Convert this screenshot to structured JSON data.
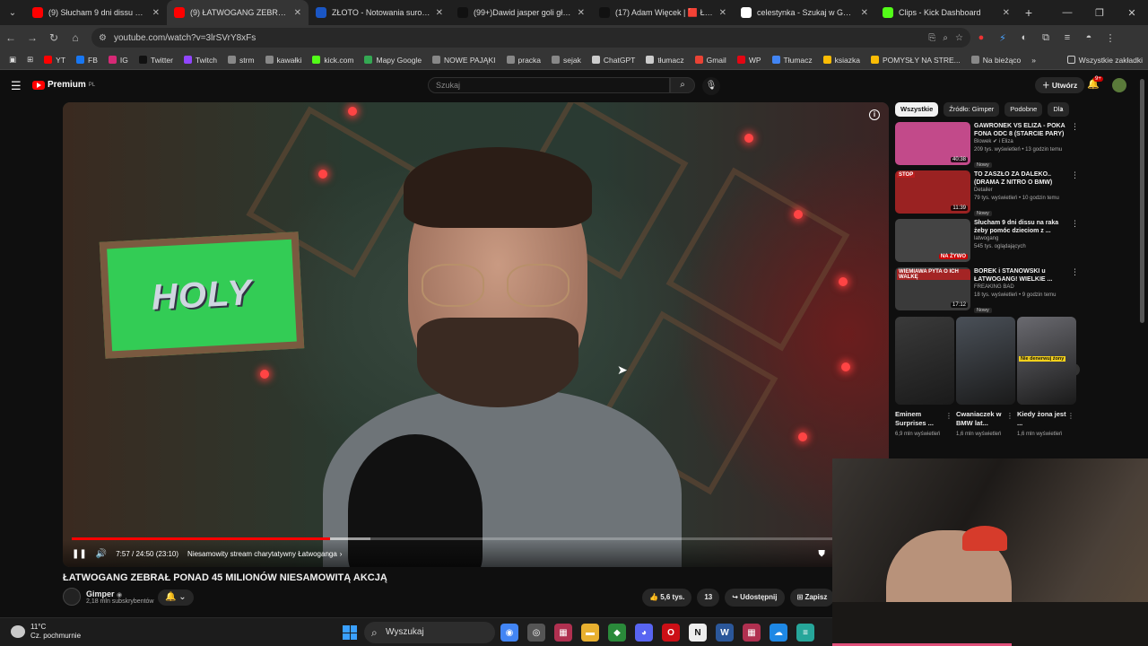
{
  "tabs": [
    {
      "title": "(9) Słucham 9 dni dissu na raka",
      "icon": "youtube-icon",
      "color": "#ff0000",
      "active": false
    },
    {
      "title": "(9) ŁATWOGANG ZEBRAŁ P",
      "icon": "youtube-icon",
      "color": "#ff0000",
      "active": true
    },
    {
      "title": "ZŁOTO - Notowania surowców",
      "icon": "bankier-icon",
      "color": "#1a56c4",
      "active": false
    },
    {
      "title": "(99+)Dawid jasper goli głowę",
      "icon": "tiktok-icon",
      "color": "#111111",
      "active": false
    },
    {
      "title": "(17) Adam Więcek | 🟥 Łowca",
      "icon": "x-icon",
      "color": "#111111",
      "active": false
    },
    {
      "title": "celestynka - Szukaj w Google",
      "icon": "google-icon",
      "color": "#ffffff",
      "active": false
    },
    {
      "title": "Clips - Kick Dashboard",
      "icon": "kick-icon",
      "color": "#53fc18",
      "active": false
    }
  ],
  "address": {
    "url": "youtube.com/watch?v=3lrSVrY8xFs"
  },
  "bookmarks": [
    {
      "label": "YT",
      "color": "#ff0000"
    },
    {
      "label": "FB",
      "color": "#1877f2"
    },
    {
      "label": "IG",
      "color": "#d62976"
    },
    {
      "label": "Twitter",
      "color": "#111111"
    },
    {
      "label": "Twitch",
      "color": "#9146ff"
    },
    {
      "label": "strm",
      "color": "#888888"
    },
    {
      "label": "kawałki",
      "color": "#888888"
    },
    {
      "label": "kick.com",
      "color": "#53fc18"
    },
    {
      "label": "Mapy Google",
      "color": "#34a853"
    },
    {
      "label": "NOWE PAJĄKI",
      "color": "#888888"
    },
    {
      "label": "pracka",
      "color": "#888888"
    },
    {
      "label": "sejak",
      "color": "#888888"
    },
    {
      "label": "ChatGPT",
      "color": "#cccccc"
    },
    {
      "label": "tłumacz",
      "color": "#cccccc"
    },
    {
      "label": "Gmail",
      "color": "#ea4335"
    },
    {
      "label": "WP",
      "color": "#e30613"
    },
    {
      "label": "Tłumacz",
      "color": "#4285f4"
    },
    {
      "label": "ksiazka",
      "color": "#fbbc05"
    },
    {
      "label": "POMYSŁY NA STRE...",
      "color": "#fbbc05"
    },
    {
      "label": "Na bieżąco",
      "color": "#888888"
    }
  ],
  "bookmarks_all": "Wszystkie zakładki",
  "youtube": {
    "brand": "Premium",
    "brand_region": "PL",
    "search_placeholder": "Szukaj",
    "create_label": "Utwórz",
    "notifications": "9+"
  },
  "player": {
    "sign_text": "HOLY",
    "time": "7:57 / 24:50 (23:10)",
    "chapter": "Niesamowity stream charytatywny Łatwoganga",
    "progress": 0.32,
    "buffered": 0.05
  },
  "video": {
    "title": "ŁATWOGANG ZEBRAŁ PONAD 45 MILIONÓW NIESAMOWITĄ AKCJĄ",
    "channel": "Gimper",
    "subscribers": "2,18 mln subskrybentów",
    "likes": "5,6 tys.",
    "comments": "13",
    "share": "Udostępnij",
    "save": "Zapisz"
  },
  "chips": [
    "Wszystkie",
    "Źródło: Gimper",
    "Podobne",
    "Dla"
  ],
  "recommendations": [
    {
      "title": "GAWRONEK VS ELIZA - POKA FONA ODC 8 (STARCIE PARY)",
      "channel": "Blowek ✔ i Eliza",
      "meta": "209 tys. wyświetleń • 13 godzin temu",
      "badge": "Nowy",
      "duration": "40:38",
      "thumb": "#c24a8a"
    },
    {
      "title": "TO ZASZŁO ZA DALEKO.. (DRAMA Z NITRO O BMW)",
      "channel": "Detailer",
      "meta": "79 tys. wyświetleń • 10 godzin temu",
      "badge": "Nowy",
      "duration": "11:39",
      "thumb": "#9a2222"
    },
    {
      "title": "Słucham 9 dni dissu na raka żeby pomóc dzieciom z ...",
      "channel": "latwogang",
      "meta": "545 tys. oglądających",
      "badge": "",
      "duration": "NA ŻYWO",
      "thumb": "#444444"
    },
    {
      "title": "BOREK i STANOWSKI u ŁATWOGANG! WIELKIE ...",
      "channel": "FREAKING BAD",
      "meta": "18 tys. wyświetleń • 9 godzin temu",
      "badge": "Nowy",
      "duration": "17:12",
      "thumb": "#3a3a3a"
    }
  ],
  "recommendation_thumb_text": [
    "",
    "STOP",
    "",
    "WIEMIAWA PYTA O ICH WALKĘ"
  ],
  "shorts": [
    {
      "title": "Eminem Surprises ...",
      "views": "6,9 mln wyświetleń",
      "thumb": "#3a3a3a",
      "tag": ""
    },
    {
      "title": "Cwaniaczek w BMW lat...",
      "views": "1,6 mln wyświetleń",
      "thumb": "#4a5058",
      "tag": ""
    },
    {
      "title": "Kiedy żona jest ...",
      "views": "1,6 mln wyświetleń",
      "thumb": "#6a6a70",
      "tag": "Nie denerwuj żony"
    }
  ],
  "taskbar": {
    "temp": "11°C",
    "weather": "Cz. pochmurnie",
    "search": "Wyszukaj",
    "apps": [
      {
        "name": "chrome-icon",
        "color": "#4285f4",
        "label": "◉"
      },
      {
        "name": "app-icon",
        "color": "#555555",
        "label": "◎"
      },
      {
        "name": "photos-icon",
        "color": "#b03050",
        "label": "▦"
      },
      {
        "name": "folder-icon",
        "color": "#e8b030",
        "label": "▬"
      },
      {
        "name": "shield-icon",
        "color": "#2a8a3a",
        "label": "◆"
      },
      {
        "name": "discord-icon",
        "color": "#5865f2",
        "label": "◕"
      },
      {
        "name": "opera-icon",
        "color": "#cc0f16",
        "label": "O"
      },
      {
        "name": "notion-icon",
        "color": "#eeeeee",
        "label": "N"
      },
      {
        "name": "word-icon",
        "color": "#2b579a",
        "label": "W"
      },
      {
        "name": "media-icon",
        "color": "#b03050",
        "label": "▦"
      },
      {
        "name": "cloud-icon",
        "color": "#1e88e5",
        "label": "☁"
      },
      {
        "name": "notes-icon",
        "color": "#26a69a",
        "label": "≡"
      }
    ]
  }
}
